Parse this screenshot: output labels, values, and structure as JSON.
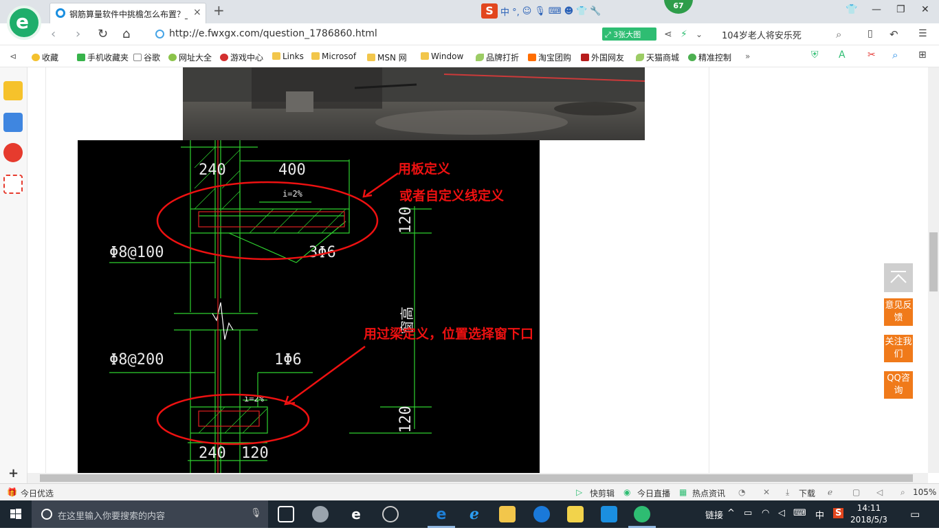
{
  "browser": {
    "tab_title": "钢筋算量软件中挑檐怎么布置？_",
    "tab_close": "×",
    "new_tab": "+",
    "weather_count": "67",
    "sogou_ime_label": "中 °,",
    "url": "http://e.fwxgx.com/question_1786860.html",
    "big_image_button": "3张大图",
    "news_headline": "104岁老人将安乐死",
    "window_buttons": [
      "⌂",
      "—",
      "❐",
      "✕"
    ]
  },
  "favorites": [
    {
      "label": "收藏",
      "icon": "star-icon"
    },
    {
      "label": "手机收藏夹",
      "icon": "phone-icon"
    },
    {
      "label": "谷歌",
      "icon": "page-icon"
    },
    {
      "label": "网址大全",
      "icon": "globe-icon"
    },
    {
      "label": "游戏中心",
      "icon": "game-icon"
    },
    {
      "label": "Links",
      "icon": "folder-icon"
    },
    {
      "label": "Microsof",
      "icon": "folder-icon"
    },
    {
      "label": "MSN 网",
      "icon": "folder-icon"
    },
    {
      "label": "Window",
      "icon": "folder-icon"
    },
    {
      "label": "品牌打折",
      "icon": "leaf-icon"
    },
    {
      "label": "淘宝团购",
      "icon": "taobao-icon"
    },
    {
      "label": "外国网友",
      "icon": "bookmark-icon"
    },
    {
      "label": "天猫商城",
      "icon": "leaf-icon"
    },
    {
      "label": "精准控制",
      "icon": "wechat-icon"
    }
  ],
  "favorites_more": "»",
  "cad_drawing": {
    "dim_top_wall": "240",
    "dim_top_overhang": "400",
    "slope_top": "i=2%",
    "dim_right_top": "120",
    "rebar_stirrup_top": "Φ8@100",
    "rebar_main_top": "3Φ6",
    "height_label": "窗高",
    "rebar_stirrup_bottom": "Φ8@200",
    "rebar_main_bottom": "1Φ6",
    "slope_bottom": "i=2%",
    "dim_right_bottom": "120",
    "dim_bottom_wall": "240",
    "dim_bottom_sill": "120",
    "annotation_1_line1": "用板定义",
    "annotation_1_line2": "或者自定义线定义",
    "annotation_2": "用过梁定义，位置选择窗下口"
  },
  "float_buttons": {
    "feedback": "意见反馈",
    "follow": "关注我们",
    "qq": "QQ咨询"
  },
  "statusbar": {
    "today_picks": "今日优选",
    "quick_cut": "快剪辑",
    "live": "今日直播",
    "hot_news": "热点资讯",
    "download": "下载",
    "zoom": "105%"
  },
  "taskbar": {
    "search_placeholder": "在这里输入你要搜索的内容",
    "tray_link": "链接",
    "ime": "中",
    "time": "14:11",
    "date": "2018/5/3"
  },
  "colors": {
    "cad_line": "#2fd12f",
    "annotation": "#ee1111",
    "float_orange": "#f07a1a",
    "brand_green": "#1fae6b"
  }
}
